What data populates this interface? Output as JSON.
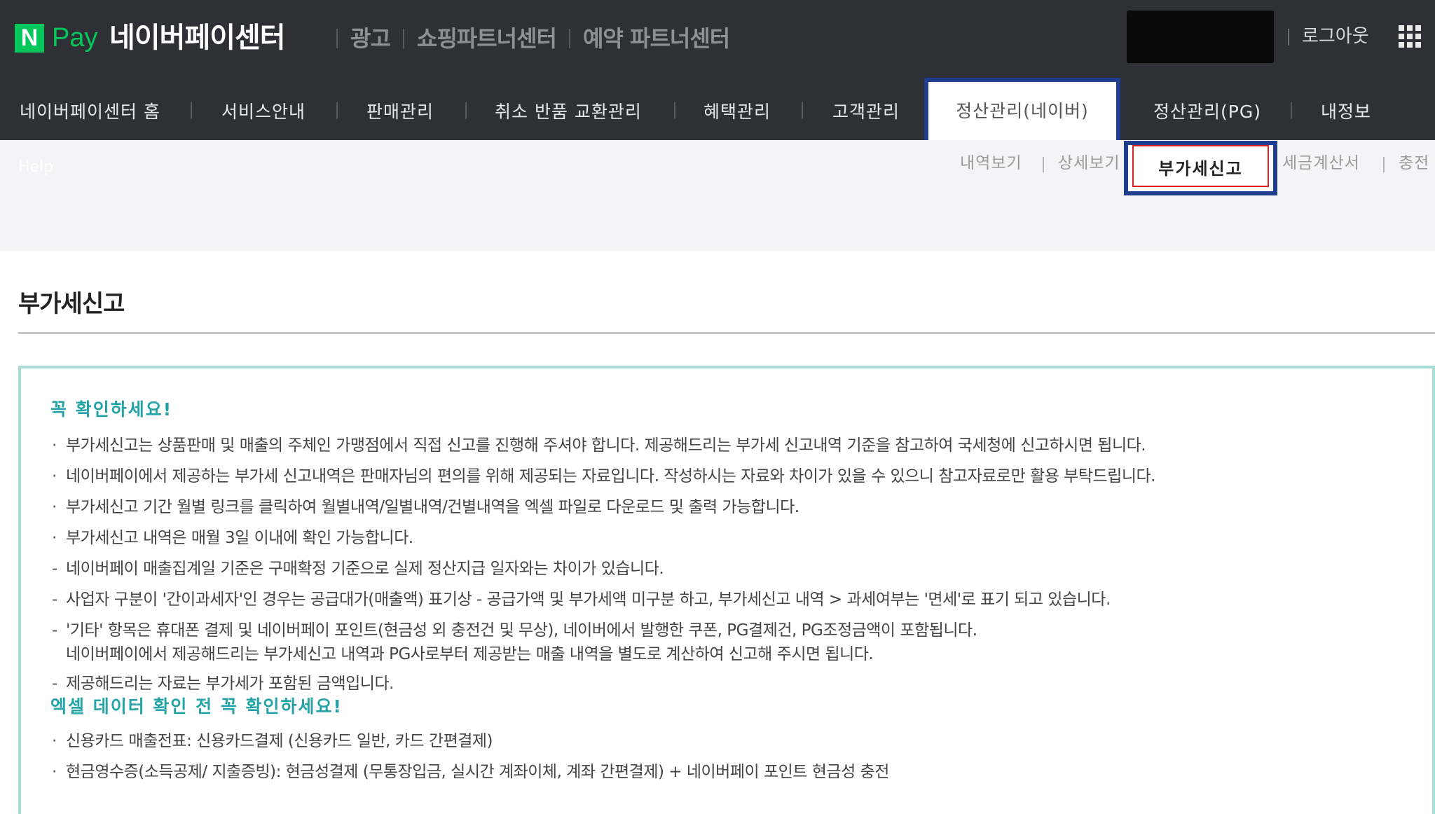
{
  "header": {
    "logo_mark": "N",
    "logo_pay": "Pay",
    "site_title": "네이버페이센터",
    "top_links": [
      "광고",
      "쇼핑파트너센터",
      "예약 파트너센터"
    ],
    "logout_label": "로그아웃"
  },
  "nav": {
    "items": [
      "네이버페이센터 홈",
      "서비스안내",
      "판매관리",
      "취소 반품 교환관리",
      "혜택관리",
      "고객관리",
      "정산관리(네이버)",
      "정산관리(PG)",
      "내정보"
    ],
    "active_index": 6
  },
  "subnav": {
    "help_label": "Help",
    "items": [
      "내역보기",
      "상세보기",
      "부가세신고",
      "세금계산서",
      "충전"
    ],
    "active_index": 2
  },
  "page": {
    "title": "부가세신고"
  },
  "notice": {
    "heading1": "꼭 확인하세요!",
    "lines": [
      {
        "marker": "·",
        "text": "부가세신고는 상품판매 및 매출의 주체인 가맹점에서 직접 신고를 진행해 주셔야 합니다. 제공해드리는 부가세 신고내역 기준을 참고하여 국세청에 신고하시면 됩니다."
      },
      {
        "marker": "·",
        "text": "네이버페이에서 제공하는 부가세 신고내역은 판매자님의 편의를 위해 제공되는 자료입니다. 작성하시는 자료와 차이가 있을 수 있으니 참고자료로만 활용 부탁드립니다."
      },
      {
        "marker": "·",
        "text": "부가세신고 기간 월별 링크를 클릭하여 월별내역/일별내역/건별내역을 엑셀 파일로 다운로드 및 출력 가능합니다."
      },
      {
        "marker": "·",
        "text": "부가세신고 내역은 매월 3일 이내에 확인 가능합니다."
      },
      {
        "marker": "-",
        "text": "네이버페이 매출집계일 기준은 구매확정 기준으로 실제 정산지급 일자와는 차이가 있습니다."
      },
      {
        "marker": "-",
        "text": "사업자 구분이 '간이과세자'인 경우는 공급대가(매출액) 표기상 - 공급가액 및 부가세액 미구분 하고, 부가세신고 내역 > 과세여부는 '면세'로 표기 되고 있습니다."
      },
      {
        "marker": "-",
        "text": "'기타' 항목은 휴대폰 결제 및 네이버페이 포인트(현금성 외 충전건 및 무상), 네이버에서 발행한 쿠폰, PG결제건, PG조정금액이 포함됩니다."
      },
      {
        "marker": "",
        "text": "네이버페이에서 제공해드리는 부가세신고 내역과 PG사로부터 제공받는 매출 내역을 별도로 계산하여 신고해 주시면 됩니다."
      },
      {
        "marker": "-",
        "text": "제공해드리는 자료는 부가세가 포함된 금액입니다."
      }
    ],
    "heading2": "엑셀 데이터 확인 전 꼭 확인하세요!",
    "lines2": [
      {
        "marker": "·",
        "text": "신용카드 매출전표: 신용카드결제 (신용카드 일반, 카드 간편결제)"
      },
      {
        "marker": "·",
        "text": "현금영수증(소득공제/ 지출증빙): 현금성결제 (무통장입금, 실시간 계좌이체, 계좌 간편결제) + 네이버페이 포인트 현금성 충전"
      }
    ]
  },
  "colors": {
    "header_bg": "#2e3035",
    "brand_green": "#03c75a",
    "highlight_blue": "#1f3d8f",
    "notice_teal": "#24a3a7",
    "notice_border": "#a8dcd7"
  }
}
